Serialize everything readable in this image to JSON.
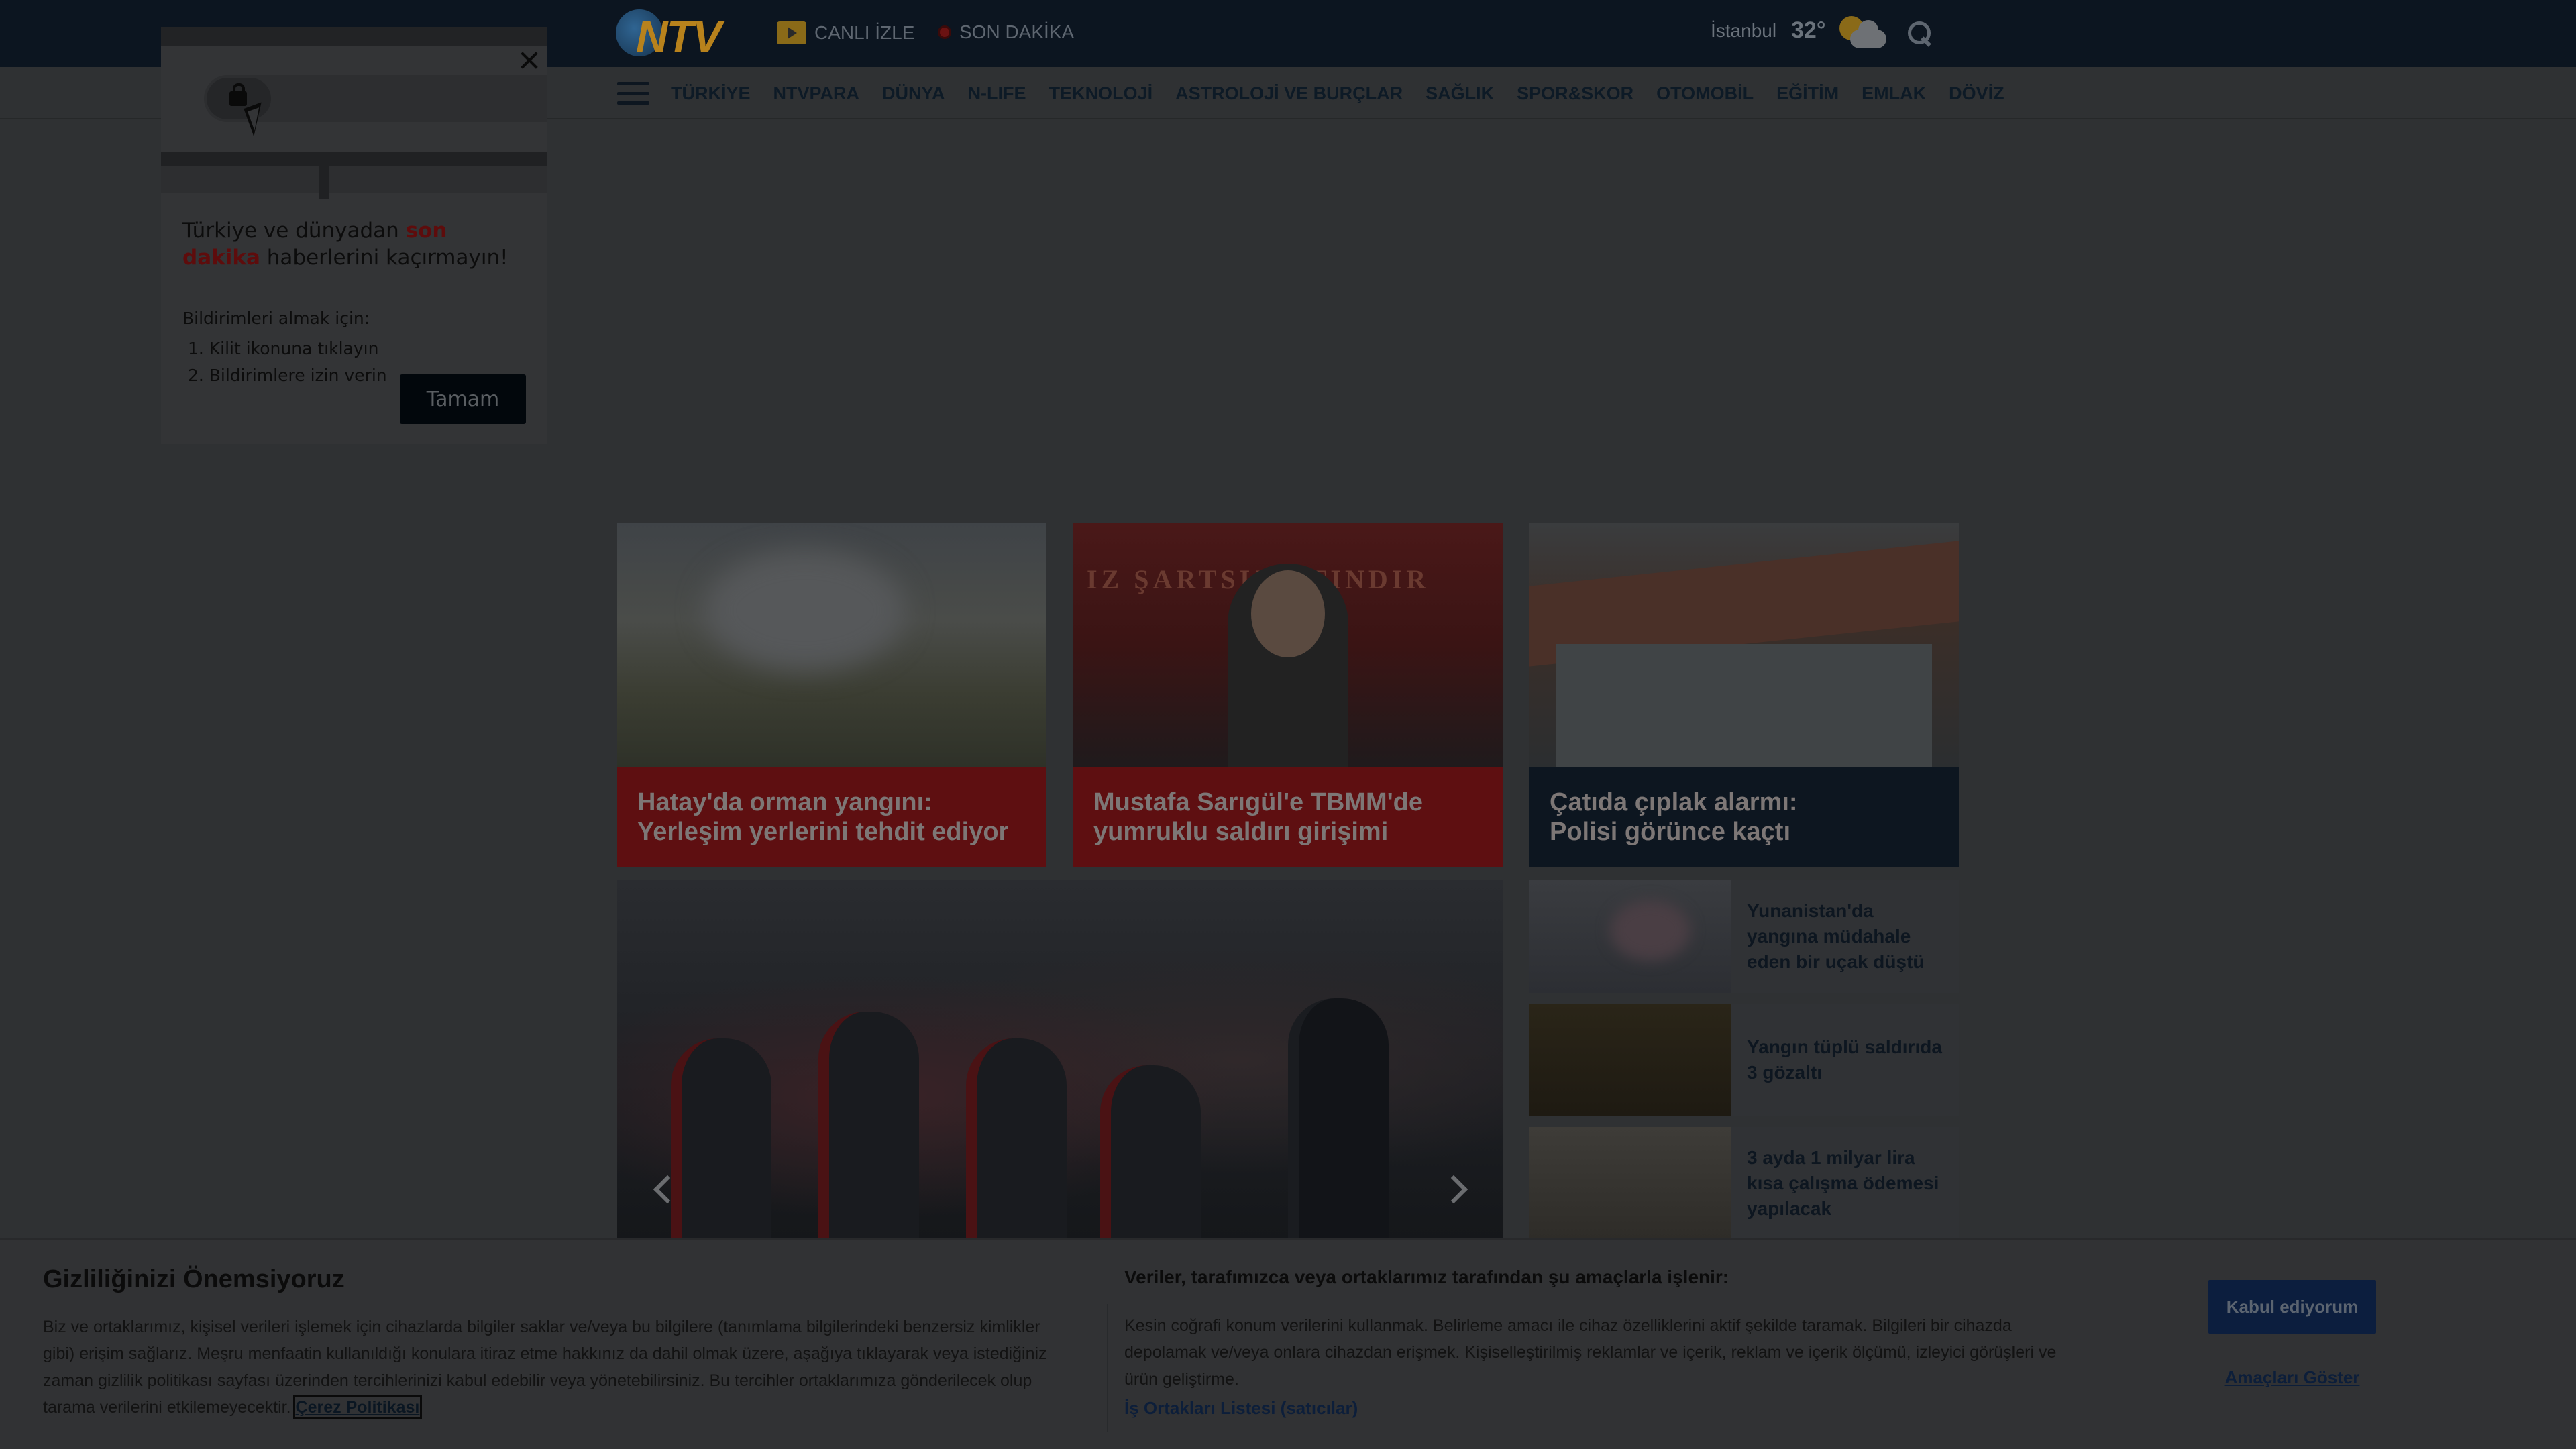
{
  "header": {
    "logo_text": "NTV",
    "live_label": "CANLI İZLE",
    "breaking_label": "SON DAKİKA",
    "city": "İstanbul",
    "temperature": "32°",
    "weather_icon": "partly-cloudy-icon",
    "search_icon": "search-icon"
  },
  "nav": {
    "menu_icon": "hamburger-menu-icon",
    "items": [
      "TÜRKİYE",
      "NTVPARA",
      "DÜNYA",
      "N-LIFE",
      "TEKNOLOJİ",
      "ASTROLOJİ VE BURÇLAR",
      "SAĞLIK",
      "SPOR&SKOR",
      "OTOMOBİL",
      "EĞİTİM",
      "EMLAK",
      "DÖVİZ"
    ]
  },
  "headlines": [
    {
      "line1": "Hatay'da orman yangını:",
      "line2": "Yerleşim yerlerini tehdit ediyor"
    },
    {
      "line1": "Mustafa Sarıgül'e TBMM'de",
      "line2": "yumruklu saldırı girişimi"
    },
    {
      "line1": "Çatıda çıplak alarmı:",
      "line2": "Polisi görünce kaçtı"
    }
  ],
  "side_news": [
    {
      "title": "Yunanistan'da yangına müdahale eden bir uçak düştü"
    },
    {
      "title": "Yangın tüplü saldırıda 3 gözaltı"
    },
    {
      "title": "3 ayda 1 milyar lira kısa çalışma ödemesi yapılacak"
    }
  ],
  "notification_popup": {
    "text_before": "Türkiye ve dünyadan ",
    "text_highlight": "son dakika",
    "text_after": " haberlerini kaçırmayın!",
    "subtitle": "Bildirimleri almak için:",
    "steps": [
      "Kilit ikonuna tıklayın",
      "Bildirimlere izin verin"
    ],
    "ok_label": "Tamam"
  },
  "cookie_banner": {
    "title": "Gizliliğinizi Önemsiyoruz",
    "body": "Biz ve ortaklarımız, kişisel verileri işlemek için cihazlarda bilgiler saklar ve/veya bu bilgilere (tanımlama bilgilerindeki benzersiz kimlikler gibi) erişim sağlarız. Meşru menfaatin kullanıldığı konulara itiraz etme hakkınız da dahil olmak üzere, aşağıya tıklayarak veya istediğiniz zaman gizlilik politikası sayfası üzerinden tercihlerinizi kabul edebilir veya yönetebilirsiniz. Bu tercihler ortaklarımıza gönderilecek olup tarama verilerini etkilemeyecektir.",
    "policy_link": "Çerez Politikası",
    "purposes_heading": "Veriler, tarafımızca veya ortaklarımız tarafından şu amaçlarla işlenir:",
    "purposes_body": "Kesin coğrafi konum verilerini kullanmak. Belirleme amacı ile cihaz özelliklerini aktif şekilde taramak. Bilgileri bir cihazda depolamak ve/veya onlara cihazdan erişmek. Kişiselleştirilmiş reklamlar ve içerik, reklam ve içerik ölçümü, izleyici görüşleri ve ürün geliştirme.",
    "vendors_link": "İş Ortakları Listesi (satıcılar)",
    "accept_label": "Kabul ediyorum",
    "show_purposes_label": "Amaçları Göster"
  }
}
